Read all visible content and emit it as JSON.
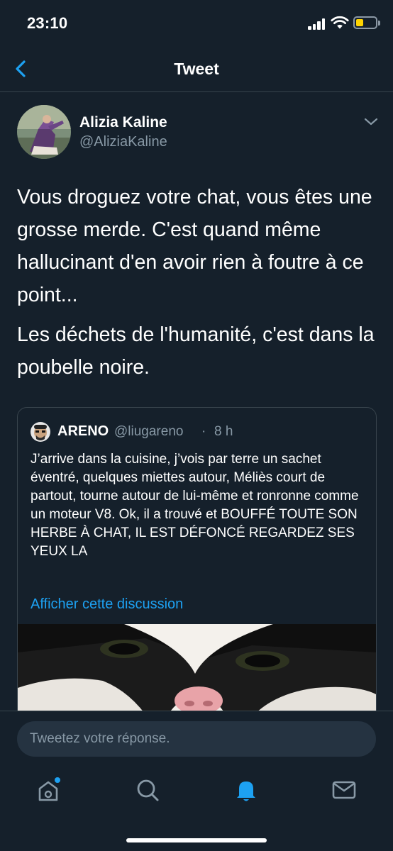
{
  "status_bar": {
    "time": "23:10",
    "battery_color": "#ffd400"
  },
  "header": {
    "title": "Tweet",
    "back_icon": "chevron-left-icon"
  },
  "tweet": {
    "author_name": "Alizia Kaline",
    "author_handle": "@AliziaKaline",
    "paragraphs": [
      "Vous droguez votre chat, vous êtes une grosse merde. C'est quand même hallucinant d'en avoir rien à foutre à ce point...",
      "Les déchets de l'humanité, c'est dans la poubelle noire."
    ]
  },
  "quoted_tweet": {
    "author_name": "ARENO",
    "author_handle": "@liugareno",
    "separator": "·",
    "time": "8 h",
    "text": "J’arrive dans la cuisine, j’vois par terre un sachet éventré, quelques miettes autour, Méliès court de partout, tourne autour de lui-même et ronronne comme un moteur V8. Ok, il a trouvé et BOUFFÉ TOUTE SON HERBE À CHAT, IL EST DÉFONCÉ REGARDEZ SES YEUX LA",
    "link": "Afficher cette discussion"
  },
  "reply": {
    "placeholder": "Tweetez votre réponse."
  },
  "tabs": [
    {
      "name": "home",
      "icon": "home-icon",
      "active": false,
      "has_dot": true
    },
    {
      "name": "search",
      "icon": "search-icon",
      "active": false
    },
    {
      "name": "notifications",
      "icon": "bell-icon",
      "active": true
    },
    {
      "name": "messages",
      "icon": "mail-icon",
      "active": false
    }
  ],
  "colors": {
    "accent": "#1da1f2",
    "background": "#15202b",
    "secondary_text": "#8899a6",
    "border": "#38444d"
  }
}
